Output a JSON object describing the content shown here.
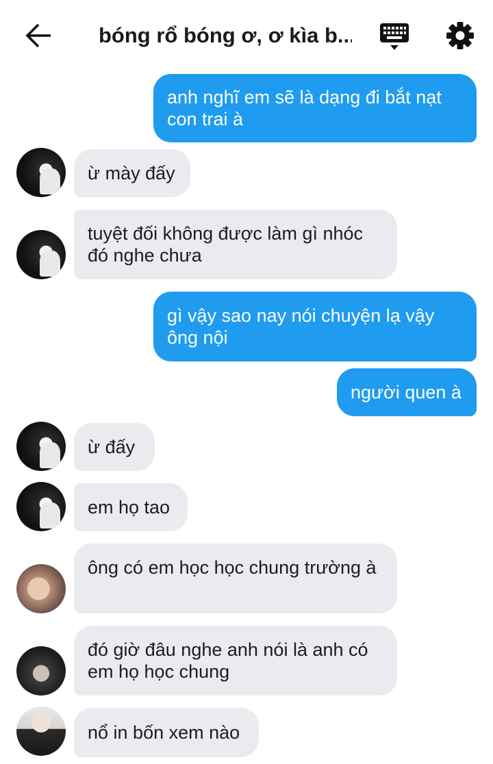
{
  "header": {
    "title": "bóng rổ bóng ơ, ơ kìa b...",
    "back_icon": "arrow-left-icon",
    "keyboard_icon": "keyboard-icon",
    "settings_icon": "gear-icon"
  },
  "colors": {
    "outgoing_bubble": "#1f9bf0",
    "incoming_bubble": "#e9ebef",
    "background": "#ffffff"
  },
  "messages": [
    {
      "dir": "out",
      "text": "anh nghĩ em sẽ là dạng đi bắt nạt con trai à"
    },
    {
      "dir": "in",
      "text": "ừ mày đấy"
    },
    {
      "dir": "in",
      "text": "tuyệt đối không được làm gì nhóc đó nghe chưa"
    },
    {
      "dir": "out",
      "text": "gì vậy sao nay nói chuyện lạ vậy ông nội"
    },
    {
      "dir": "out",
      "text": "người quen à"
    },
    {
      "dir": "in",
      "text": "ừ đấy"
    },
    {
      "dir": "in",
      "text": "em họ tao"
    },
    {
      "dir": "in",
      "text": "ông có em học học chung trường à"
    },
    {
      "dir": "in",
      "text": "đó giờ đâu nghe anh nói là anh có em họ học chung"
    },
    {
      "dir": "in",
      "text": "nổ in bốn xem nào"
    }
  ]
}
